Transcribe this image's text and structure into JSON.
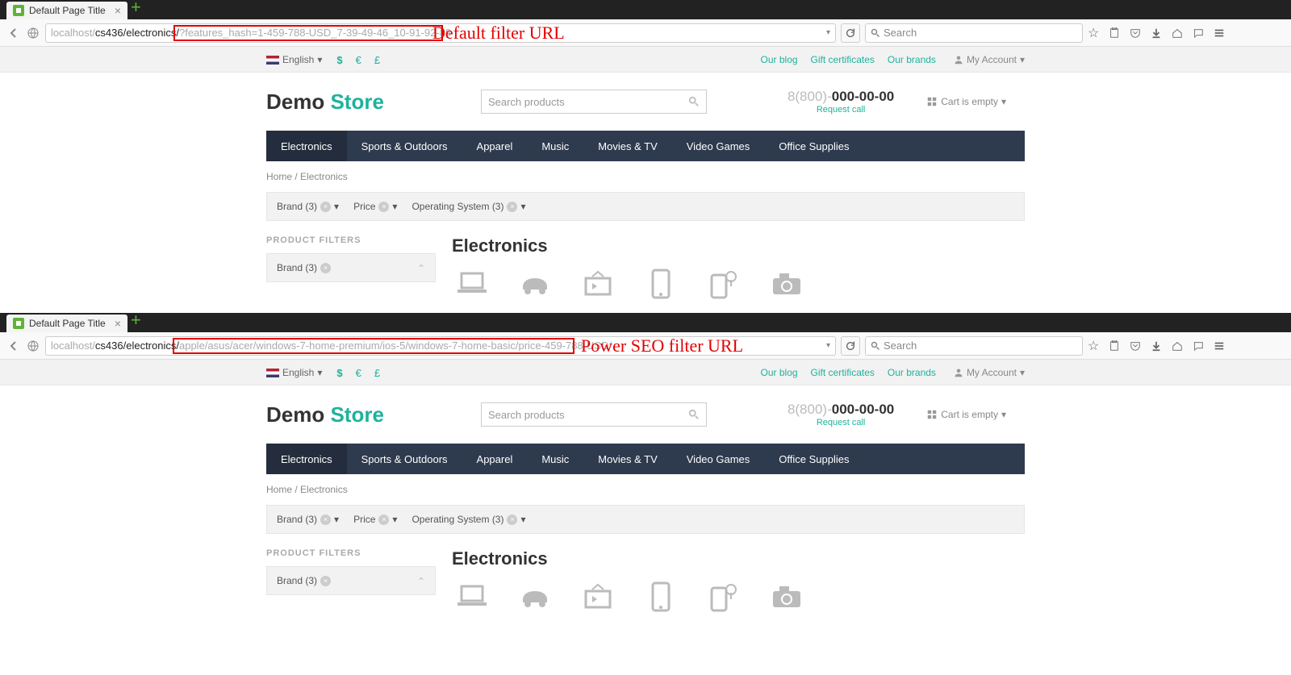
{
  "screenshots": {
    "top": {
      "tab_title": "Default Page Title",
      "url_prefix_gray": "localhost/",
      "url_prefix_black": "cs436/electronics/",
      "url_highlighted": "?features_hash=1-459-788-USD_7-39-49-46_10-91-92-88",
      "search_placeholder": "Search",
      "annotation": "Default filter URL"
    },
    "bottom": {
      "tab_title": "Default Page Title",
      "url_prefix_gray": "localhost/",
      "url_prefix_black": "cs436/electronics/",
      "url_highlighted": "apple/asus/acer/windows-7-home-premium/ios-5/windows-7-home-basic/price-459-788-USD/",
      "search_placeholder": "Search",
      "annotation": "Power SEO filter URL"
    }
  },
  "topbar": {
    "language": "English",
    "currencies": [
      "$",
      "€",
      "£"
    ],
    "links": [
      "Our blog",
      "Gift certificates",
      "Our brands"
    ],
    "account": "My Account"
  },
  "header": {
    "logo_demo": "Demo ",
    "logo_store": "Store",
    "search_placeholder": "Search products",
    "phone_gray": "8(800)-",
    "phone_bold": "000-00-00",
    "request_call": "Request call",
    "cart": "Cart is empty"
  },
  "nav": [
    "Electronics",
    "Sports & Outdoors",
    "Apparel",
    "Music",
    "Movies & TV",
    "Video Games",
    "Office Supplies"
  ],
  "breadcrumb": {
    "home": "Home",
    "sep": " / ",
    "current": "Electronics"
  },
  "filters": [
    {
      "label": "Brand (3)",
      "clearable": true,
      "dropdown": true
    },
    {
      "label": "Price",
      "clearable": true,
      "dropdown": true
    },
    {
      "label": "Operating System (3)",
      "clearable": true,
      "dropdown": true
    }
  ],
  "sidebar": {
    "title": "PRODUCT FILTERS",
    "box": "Brand (3)"
  },
  "main": {
    "heading": "Electronics"
  }
}
